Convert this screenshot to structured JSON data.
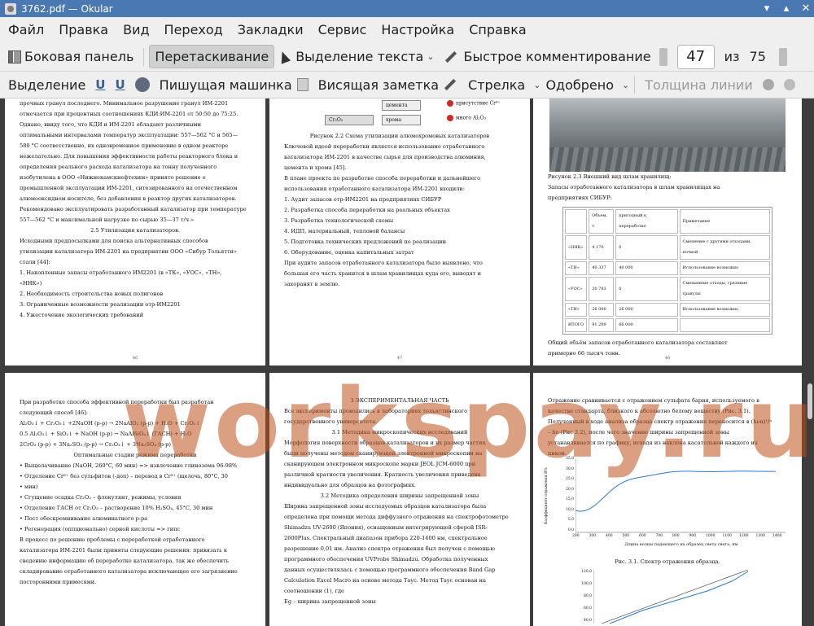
{
  "window": {
    "title": "3762.pdf — Okular"
  },
  "menu": [
    "Файл",
    "Правка",
    "Вид",
    "Переход",
    "Закладки",
    "Сервис",
    "Настройка",
    "Справка"
  ],
  "toolbar1": {
    "sidebar": "Боковая панель",
    "drag": "Перетаскивание",
    "text_select": "Выделение текста",
    "quick_comment": "Быстрое комментирование",
    "page_current": "47",
    "page_of": "из",
    "page_total": "75"
  },
  "toolbar2": {
    "highlight": "Выделение",
    "typewriter": "Пишущая машинка",
    "sticky_note": "Висящая заметка",
    "arrow": "Стрелка",
    "approved": "Одобрено",
    "line_width": "Толщина линии"
  },
  "watermark": "workspay.ru",
  "pages": {
    "p1": {
      "lines": [
        "прочных гранул последнего. Минимальное разрушение гранул ИМ-2201",
        "отмечается при процентных соотношениях КДИ:ИМ-2201 от 50:50 до 75:25.",
        "Однако, ввиду того, что КДИ и ИМ-2201 обладают различными",
        "оптимальными интервалами температур эксплуатации: 557—562 °С и 565—",
        "580 °С соответственно, их одновременное применение в одном реакторе",
        "нежелательно. Для повышения эффективности работы реакторного блока и",
        "определения реального расхода катализатора на тонну полученного",
        "изобутилена в ООО «Нижнекамскнефтехим» принято решение о",
        "промышленной эксплуатации ИМ-2201, ситезированного на отечественном",
        "алюмооксидном носителе, без добавления в реактор других катализаторов.",
        "Рекомендовано эксплуатировать разработанный катализатор при температуре",
        "557—562 °С и максимальной нагрузке по сырью 35—37 т/ч.»"
      ],
      "heading": "2.5 Утилизация катализаторов.",
      "para2": [
        "Исходными предпосылками для поиска альтернативных способов",
        "утилизации катализатора ИМ-2201 на предприятии ООО «Сибур Тольятти»",
        "стали [44]:"
      ],
      "list": [
        "1. Накопленные запасы отработанного ИМ2201 (в «ТК», «УОС», «ТН»,",
        "«ННК»)",
        "2. Необходимость строительства новых полигонов",
        "3. Ограниченные возможности реализации отр-ИМ2201",
        "4. Ужесточение экологических требований"
      ],
      "num": "46"
    },
    "p2": {
      "scheme_a": "цемента",
      "scheme_b": "хрома",
      "scheme_c": "Cr₂O₃",
      "res1": "присутствие Cr⁶⁺",
      "res2": "много Al₂O₃",
      "caption": "Рисунок 2.2 Схема утилизации алюмохромовых катализаторов",
      "para": [
        "Ключевой идеей переработки является использование отработанного",
        "катализатора ИМ-2201 в качестве сырья для производства алюминия,",
        "цемента и хрома [45].",
        "В плане проекта по разработке способа переработки и дальнейшего",
        "использования отработанного катализатора ИМ-2201 входили:"
      ],
      "list": [
        "1. Аудит запасов отр-ИМ2201 на предприятиях СИБУР",
        "2. Разработка способа переработки на реальных объектах",
        "3. Разработка технологической схемы",
        "4. ИДП, материальный, тепловой балансы",
        "5. Подготовка технических предложений по реализации",
        "6. Оборудование, оценка капитальных затрат"
      ],
      "para2": [
        "При аудите запасов отработанного катализатора было выявлено, что",
        "большая его часть хранится в шлам хранилищах куда его, выводят и",
        "захоранят в землю."
      ],
      "num": "47"
    },
    "p3": {
      "caption": "Рисунок 2.3 Внешний вид шлам хранилищ:",
      "para": [
        "Запасы отработанного катализатора в шлам хранилищах на",
        "предприятиях СИБУР:"
      ],
      "table_head": [
        "Объем, т",
        "пригодный к переработке",
        "Примечание"
      ],
      "table_rows": [
        [
          "«ННК»",
          "4 170",
          "0",
          "Смешение с другими отходами, почвой"
        ],
        [
          "«ТН»",
          "40 337",
          "40 000",
          "Использование возможно"
        ],
        [
          "«УОС»",
          "20 783",
          "0",
          "Смешанные отходы, грязевые гранулы"
        ],
        [
          "«ТН»",
          "26 000",
          "26 000",
          "Использование возможно"
        ],
        [
          "ИТОГО",
          "91 289",
          "66 000",
          ""
        ]
      ],
      "para2": [
        "Общий объём запасов отработанного катализатора составляет",
        "примерно 66 тысяч тонн."
      ],
      "num": "48"
    },
    "p4": {
      "para": [
        "При разработке способа эффективной переработки был разработан",
        "следующий способ [46]:"
      ],
      "eq": [
        "Al₂O₃↓ + Cr₂O₃↓ +2NaOH (р-р) → 2NaAlO₂ (р-р) + H₂O + Cr₂O₃↓",
        "0.5 Al₂O₃↓ + SiO₂↓ + NaOH (р-р) → NaAlSiO₄↓ (ГАСН) + H₂O",
        "2CrO₃ (р-р) + 3Na₂SO₃ (р-р) → Cr₂O₃↓ + 3Na₂SO₄ (р-р)"
      ],
      "stages": "Оптимальные стадии режима переработки",
      "bullets": [
        "Выщелачивание (NaOH, 260°C, 60 мин) => извлечение глинозема 96-98%",
        "Отделение Cr⁶⁺ без сульфитов (-доп) – перевод в Cr³⁺ (щелочь, 80°C, 30",
        "мин)",
        "Сгущение осадка Cr₂O₃ – флокулянт, режимы, условия",
        "Отделение ГАСН от Cr₂O₃ – растворение 10% H₂SO₄, 45°C, 30 мин",
        "Пост обескремнивание алюминатного р-ра",
        "Регенерация (оппционально) серной кислоты => гипс"
      ],
      "para2": [
        "В процесс по решению проблемы с переработкой отработанного",
        "катализатора ИМ-2201 были приняты следующие решения: привязать к",
        "сведению информацию об переработке катализатора, так же обеспечить",
        "складирование отработанного катализатора исключающее его загрязнение",
        "посторонними примесями."
      ]
    },
    "p5": {
      "heading": "3 ЭКСПЕРИМЕНТАЛЬНАЯ ЧАСТЬ",
      "para": [
        "Все эксперименты проводились в лабораториях тольяттинского",
        "государственного университета."
      ],
      "sub1": "3.1 Методика микроскопических исследований",
      "para2": [
        "Морфология поверхности образцов катализаторов и их размер частиц",
        "были получены методом сканирующей электронной микроскопии на",
        "сканирующем электронном микроскопе марки JEOL JCM-6000 при",
        "различной кратности увеличения. Кратность увеличения приведена",
        "индивидуально для образцов на фотографиях."
      ],
      "sub2": "3.2 Методика определения ширины запрещенной зоны",
      "para3": [
        "Ширина запрещенной зоны исследуемых образцов катализатора была",
        "определена при помощи метода диффузного отражения на спектрофотометре",
        "Shimadzu UV-2600 (Япония), оснащенным интегрирующей сферой ISR-",
        "2600Plus. Спектральный диапазон прибора 220-1400 нм, спектральное",
        "разрешение 0,01 нм. Анализ спектра отражения был получен с помощью",
        "программного обеспечения UVProbe Shimadzu. Обработка полученных",
        "данных осуществлялась с помощью программного обеспечения Band Gap",
        "Calculation Excel Macro на основе метода Таус. Метод Таус основан на",
        "соотношении (1), где",
        "Eg – ширина запрещенной зоны"
      ]
    },
    "p6": {
      "para": [
        "Отражение сравнивается с отражением сульфата бария, используемого в",
        "качестве стандарта, близкого к абсолютно белому веществу (Рис. 3.1).",
        "Полученный в ходе анализа образца спектр отражения переносится в (hνα)¹/ⁿ",
        "– hν (Рис 3.2), после чего значение ширины запрещенной зоны",
        "устанавливается по графику, исходя из наклона касательной каждого из",
        "пиков."
      ],
      "ylabel": "Коэффициент отражения R%",
      "x_ticks": [
        "200",
        "300",
        "400",
        "500",
        "600",
        "700",
        "800",
        "900",
        "1000",
        "1100",
        "1200",
        "1300",
        "1400"
      ],
      "y_ticks": [
        "35,0",
        "30,0",
        "25,0",
        "20,0",
        "15,0",
        "10,0",
        "5,0",
        "0,0"
      ],
      "xlabel": "Длина волны падающего на образец света света, нм",
      "caption": "Рис. 3.1. Спектр отражения образца.",
      "y2_ticks": [
        "120,0",
        "100,0",
        "80,0",
        "60,0",
        "40,0"
      ]
    }
  }
}
